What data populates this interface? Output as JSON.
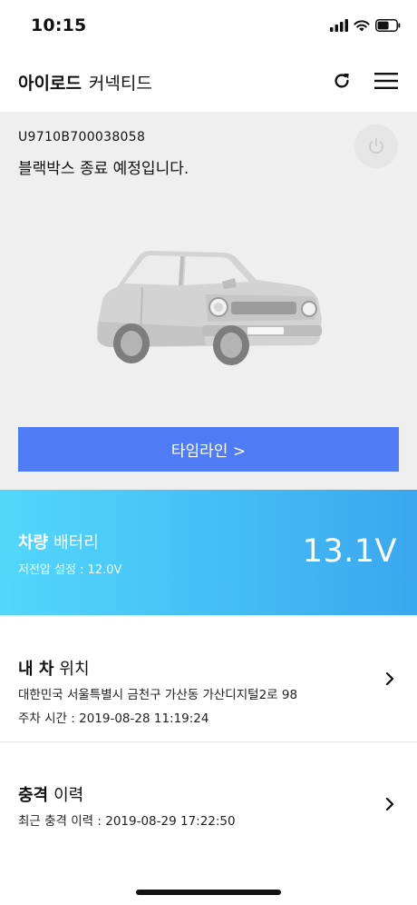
{
  "status_bar": {
    "time": "10:15"
  },
  "header": {
    "title_bold": "아이로드",
    "title_light": "커넥티드"
  },
  "device": {
    "serial": "U9710B700038058",
    "status_text": "블랙박스 종료 예정입니다.",
    "timeline_label": "타임라인 >"
  },
  "battery": {
    "title_bold": "차량",
    "title_light": "배터리",
    "low_voltage_setting": "저전압 설정 : 12.0V",
    "voltage": "13.1V"
  },
  "location": {
    "title_bold": "내 차",
    "title_light": "위치",
    "address": "대한민국 서울특별시 금천구 가산동 가산디지털2로 98",
    "parking_time": "주차 시간 : 2019-08-28 11:19:24"
  },
  "impact": {
    "title_bold": "충격",
    "title_light": "이력",
    "recent": "최근 충격 이력 : 2019-08-29 17:22:50"
  },
  "colors": {
    "accent_blue": "#4f7bf4",
    "battery_gradient_start": "#52d7fb",
    "battery_gradient_end": "#3aa7ee",
    "card_gray": "#efefef"
  },
  "icons": {
    "refresh": "refresh-icon",
    "menu": "hamburger-menu-icon",
    "power": "power-icon",
    "chevron": "chevron-right-icon"
  }
}
